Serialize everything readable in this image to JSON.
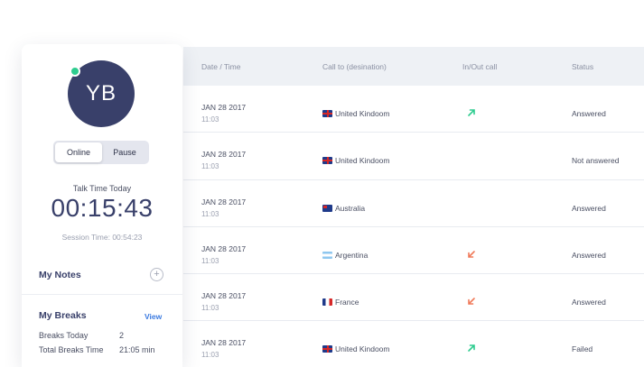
{
  "agent": {
    "initials": "YB",
    "status_toggle": {
      "online_label": "Online",
      "pause_label": "Pause",
      "selected": "Online"
    },
    "talk_time_label": "Talk Time Today",
    "talk_time_value": "00:15:43",
    "session_time": "Session Time: 00:54:23",
    "notes_title": "My Notes",
    "notes_add_symbol": "+",
    "breaks_title": "My Breaks",
    "breaks_view_label": "View",
    "breaks": [
      {
        "label": "Breaks Today",
        "value": "2"
      },
      {
        "label": "Total Breaks Time",
        "value": "21:05 min"
      }
    ]
  },
  "calls": {
    "columns": [
      "Date / Time",
      "Call to (desination)",
      "In/Out call",
      "Status"
    ],
    "rows": [
      {
        "date": "JAN 28 2017",
        "time": "11:03",
        "flag": "uk-flag-icon",
        "destination": "United Kindoom",
        "direction": "outgoing-arrow-icon",
        "status": "Answered"
      },
      {
        "date": "JAN 28 2017",
        "time": "11:03",
        "flag": "uk-flag-icon",
        "destination": "United Kindoom",
        "direction": "",
        "status": "Not answered"
      },
      {
        "date": "JAN 28 2017",
        "time": "11:03",
        "flag": "australia-flag-icon",
        "destination": "Australia",
        "direction": "",
        "status": "Answered"
      },
      {
        "date": "JAN 28 2017",
        "time": "11:03",
        "flag": "argentina-flag-icon",
        "destination": "Argentina",
        "direction": "incoming-arrow-icon",
        "status": "Answered"
      },
      {
        "date": "JAN 28 2017",
        "time": "11:03",
        "flag": "france-flag-icon",
        "destination": "France",
        "direction": "incoming-arrow-icon",
        "status": "Answered"
      },
      {
        "date": "JAN 28 2017",
        "time": "11:03",
        "flag": "uk-flag-icon",
        "destination": "United Kindoom",
        "direction": "outgoing-arrow-icon",
        "status": "Failed"
      }
    ]
  },
  "colors": {
    "accent_navy": "#39406a",
    "online_green": "#2ecc8f",
    "outgoing_green": "#2ecc8f",
    "incoming_red": "#f07a5a",
    "link_blue": "#3b7ae0"
  }
}
